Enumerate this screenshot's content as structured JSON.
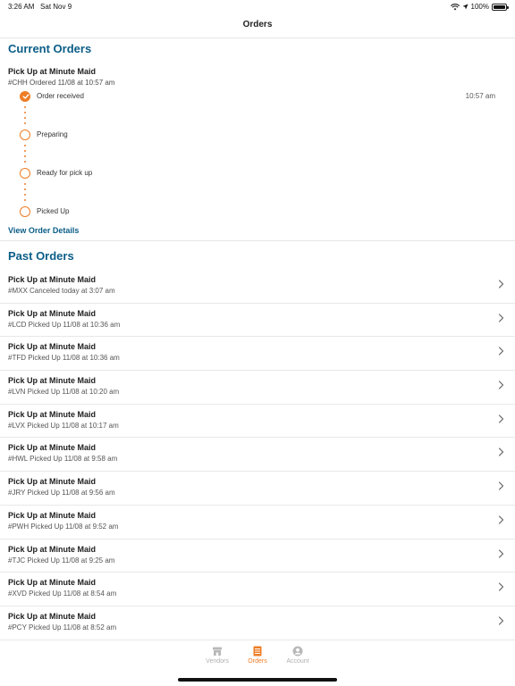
{
  "status_bar": {
    "time": "3:26 AM",
    "date": "Sat Nov 9",
    "battery": "100%",
    "battery_level": 1.0
  },
  "nav": {
    "title": "Orders"
  },
  "current_orders": {
    "section_title": "Current Orders",
    "order": {
      "heading": "Pick Up at Minute Maid",
      "subtitle": "#CHH Ordered 11/08 at 10:57 am",
      "steps": [
        {
          "label": "Order received",
          "time": "10:57 am",
          "done": true
        },
        {
          "label": "Preparing",
          "time": "",
          "done": false
        },
        {
          "label": "Ready for pick up",
          "time": "",
          "done": false
        },
        {
          "label": "Picked Up",
          "time": "",
          "done": false
        }
      ]
    },
    "view_details": "View Order Details"
  },
  "past_orders": {
    "section_title": "Past Orders",
    "items": [
      {
        "title": "Pick Up at Minute Maid",
        "subtitle": "#MXX Canceled today at 3:07 am"
      },
      {
        "title": "Pick Up at Minute Maid",
        "subtitle": "#LCD Picked Up 11/08 at 10:36 am"
      },
      {
        "title": "Pick Up at Minute Maid",
        "subtitle": "#TFD Picked Up 11/08 at 10:36 am"
      },
      {
        "title": "Pick Up at Minute Maid",
        "subtitle": "#LVN Picked Up 11/08 at 10:20 am"
      },
      {
        "title": "Pick Up at Minute Maid",
        "subtitle": "#LVX Picked Up 11/08 at 10:17 am"
      },
      {
        "title": "Pick Up at Minute Maid",
        "subtitle": "#HWL Picked Up 11/08 at 9:58 am"
      },
      {
        "title": "Pick Up at Minute Maid",
        "subtitle": "#JRY Picked Up 11/08 at 9:56 am"
      },
      {
        "title": "Pick Up at Minute Maid",
        "subtitle": "#PWH Picked Up 11/08 at 9:52 am"
      },
      {
        "title": "Pick Up at Minute Maid",
        "subtitle": "#TJC Picked Up 11/08 at 9:25 am"
      },
      {
        "title": "Pick Up at Minute Maid",
        "subtitle": "#XVD Picked Up 11/08 at 8:54 am"
      },
      {
        "title": "Pick Up at Minute Maid",
        "subtitle": "#PCY Picked Up 11/08 at 8:52 am"
      }
    ]
  },
  "tab_bar": {
    "tabs": [
      {
        "label": "Vendors",
        "icon": "store-icon",
        "active": false
      },
      {
        "label": "Orders",
        "icon": "receipt-icon",
        "active": true
      },
      {
        "label": "Account",
        "icon": "account-icon",
        "active": false
      }
    ]
  },
  "colors": {
    "accent": "#ee7d26",
    "heading_blue": "#0b5d87",
    "inactive": "#b0b0b0"
  }
}
